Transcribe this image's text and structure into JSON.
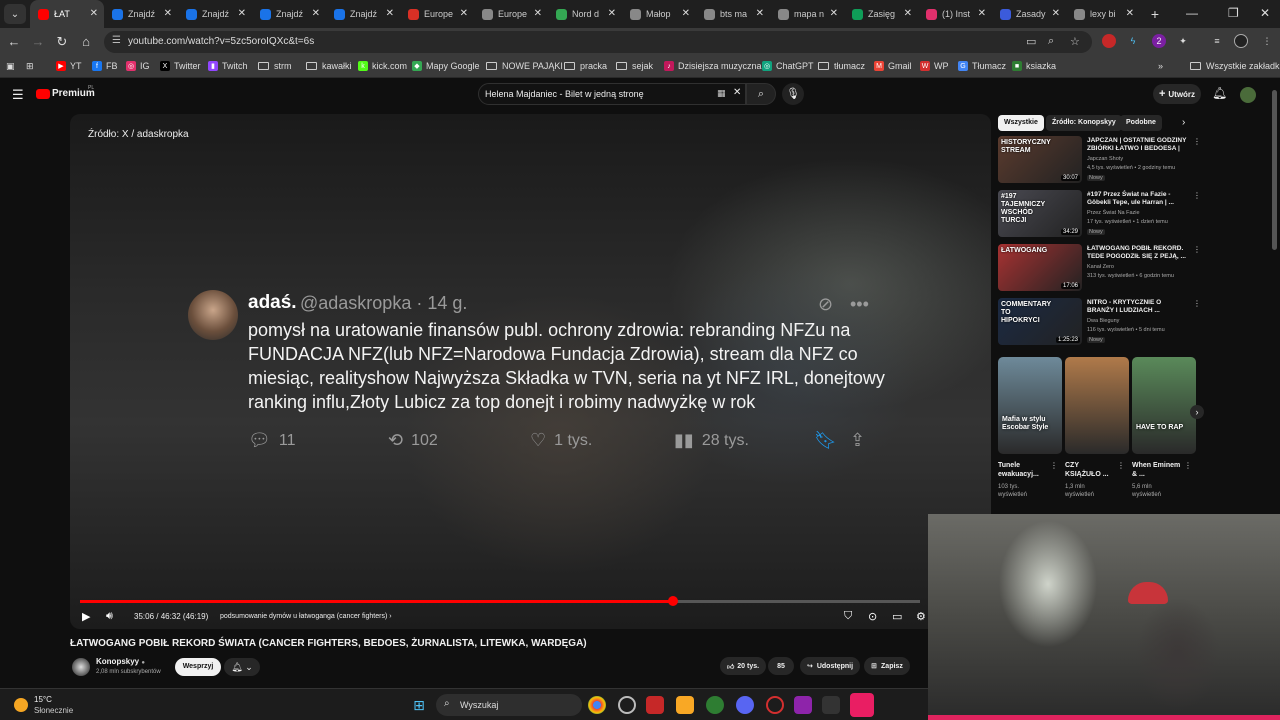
{
  "browser": {
    "tabs": [
      {
        "label": "ŁAT",
        "fav_color": "#ff0000",
        "active": true
      },
      {
        "label": "Znajdź",
        "fav_color": "#1a73e8"
      },
      {
        "label": "Znajdź",
        "fav_color": "#1a73e8"
      },
      {
        "label": "Znajdź",
        "fav_color": "#1a73e8"
      },
      {
        "label": "Znajdź",
        "fav_color": "#1a73e8"
      },
      {
        "label": "Europe",
        "fav_color": "#d93025"
      },
      {
        "label": "Europe",
        "fav_color": "#888888"
      },
      {
        "label": "Nord d",
        "fav_color": "#34a853"
      },
      {
        "label": "Małop",
        "fav_color": "#888888"
      },
      {
        "label": "bts ma",
        "fav_color": "#888888"
      },
      {
        "label": "mapa n",
        "fav_color": "#888888"
      },
      {
        "label": "Zasięg",
        "fav_color": "#0f9d58"
      },
      {
        "label": "(1) Inst",
        "fav_color": "#e1306c"
      },
      {
        "label": "Zasady",
        "fav_color": "#3b5bdb"
      },
      {
        "label": "lexy bi",
        "fav_color": "#888888"
      }
    ],
    "url": "youtube.com/watch?v=5zc5oroIQXc&t=6s",
    "bookmarks": [
      {
        "label": "YT",
        "color": "#ff0000",
        "glyph": "▶"
      },
      {
        "label": "FB",
        "color": "#1877f2",
        "glyph": "f"
      },
      {
        "label": "IG",
        "color": "#e1306c",
        "glyph": "◎"
      },
      {
        "label": "Twitter",
        "color": "#000000",
        "glyph": "X"
      },
      {
        "label": "Twitch",
        "color": "#9146ff",
        "glyph": "▮"
      },
      {
        "label": "strm",
        "folder": true
      },
      {
        "label": "kawałki",
        "folder": true
      },
      {
        "label": "kick.com",
        "color": "#53fc18",
        "glyph": "k"
      },
      {
        "label": "Mapy Google",
        "color": "#34a853",
        "glyph": "◆"
      },
      {
        "label": "NOWE PAJĄKI",
        "folder": true
      },
      {
        "label": "pracka",
        "folder": true
      },
      {
        "label": "sejak",
        "folder": true
      },
      {
        "label": "Dzisiejsza muzyczna...",
        "color": "#c2185b",
        "glyph": "♪"
      },
      {
        "label": "ChatGPT",
        "color": "#10a37f",
        "glyph": "◎"
      },
      {
        "label": "tłumacz",
        "folder": true
      },
      {
        "label": "Gmail",
        "color": "#ea4335",
        "glyph": "M"
      },
      {
        "label": "WP",
        "color": "#d32f2f",
        "glyph": "W"
      },
      {
        "label": "Tłumacz",
        "color": "#4285f4",
        "glyph": "G"
      },
      {
        "label": "ksiazka",
        "color": "#2e7d32",
        "glyph": "■"
      }
    ],
    "all_bookmarks": "Wszystkie zakładki"
  },
  "youtube": {
    "logo": "Premium",
    "logo_region": "PL",
    "search_query": "Helena Majdaniec - Bilet w jedną stronę",
    "create_label": "Utwórz",
    "video": {
      "source": "Źródło: X / adaskropka",
      "tweet": {
        "name": "adaś.",
        "handle": "@adaskropka · 14 g.",
        "body": "pomysł na uratowanie finansów publ. ochrony zdrowia: rebranding NFZu na FUNDACJA NFZ(lub NFZ=Narodowa Fundacja Zdrowia), stream dla NFZ co miesiąc, realityshow Najwyższa Składka w TVN, seria na yt NFZ IRL, donejtowy ranking influ,Złoty Lubicz za top donejt i robimy nadwyżkę w rok",
        "replies": "11",
        "reposts": "102",
        "likes": "1 tys.",
        "views": "28 tys."
      },
      "time": "35:06 / 46:32 (46:19)",
      "chapter": "podsumowanie dymów u łatwoganga (cancer fighters)",
      "progress": 0.83
    },
    "title": "ŁATWOGANG POBIŁ REKORD ŚWIATA (CANCER FIGHTERS, BEDOES, ŻURNALISTA, LITEWKA, WARDĘGA)",
    "channel": {
      "name": "Konopskyy",
      "subs": "2,08 mln subskrybentów",
      "support": "Wesprzyj"
    },
    "actions": {
      "likes": "20 tys.",
      "comments": "85",
      "share": "Udostępnij",
      "save": "Zapisz"
    },
    "chips": [
      "Wszystkie",
      "Źródło: Konopskyy",
      "Podobne"
    ],
    "recommendations": [
      {
        "thumb_text": "HISTORYCZNY STREAM",
        "duration": "30:07",
        "title": "JAPCZAN | OSTATNIE GODZINY ZBIÓRKI ŁATWO I BEDOESA |",
        "channel": "Japczan Shoty",
        "meta": "4,5 tys. wyświetleń • 2 godziny temu",
        "badge": "Nowy",
        "color": "#5b3b2e"
      },
      {
        "thumb_text": "#197 TAJEMNICZY WSCHÓD TURCJI",
        "duration": "34:29",
        "title": "#197 Przez Świat na Fazie - Göbekli Tepe, ule Harran | ...",
        "channel": "Przez Świat Na Fazie",
        "meta": "17 tys. wyświetleń • 1 dzień temu",
        "badge": "Nowy",
        "color": "#4a4a52"
      },
      {
        "thumb_text": "ŁATWOGANG",
        "duration": "17:06",
        "title": "ŁATWOGANG POBIŁ REKORD. TEDE POGODZIŁ SIĘ Z PEJĄ, ...",
        "channel": "Kanał Zero",
        "meta": "313 tys. wyświetleń • 6 godzin temu",
        "badge": "",
        "color": "#a83232"
      },
      {
        "thumb_text": "COMMENTARY TO HIPOKRYCI",
        "duration": "1:25:23",
        "title": "NITRO - KRYTYCZNIE O BRANŻY I LUDZIACH ...",
        "channel": "Dwa Bieguny",
        "meta": "116 tys. wyświetleń • 5 dni temu",
        "badge": "Nowy",
        "color": "#1b2a44"
      }
    ],
    "shorts": [
      {
        "thumb_text": "Mafia w stylu Escobar Style",
        "title": "Tunele ewakuacyj...",
        "meta": "103 tys. wyświetleń",
        "color": "#6e8a9a"
      },
      {
        "thumb_text": "",
        "title": "CZY KSIĄŻUŁO ...",
        "meta": "1,3 mln wyświetleń",
        "color": "#b07a4a"
      },
      {
        "thumb_text": "HAVE TO RAP",
        "title": "When Eminem & ...",
        "meta": "5,6 mln wyświetleń",
        "color": "#5a8a5a"
      }
    ]
  },
  "taskbar": {
    "temp": "15°C",
    "weather": "Słonecznie",
    "search": "Wyszukaj"
  },
  "icons": [
    "chevron-down-icon",
    "close-icon",
    "plus-icon",
    "minimize-icon",
    "maximize-icon",
    "back-icon",
    "forward-icon",
    "reload-icon",
    "home-icon",
    "tune-icon",
    "star-icon",
    "zoom-icon",
    "extensions-icon",
    "menu-icon",
    "search-icon",
    "mic-icon",
    "bell-icon",
    "play-icon",
    "volume-icon",
    "settings-icon",
    "like-icon",
    "share-icon",
    "save-icon",
    "windows-start-icon"
  ]
}
